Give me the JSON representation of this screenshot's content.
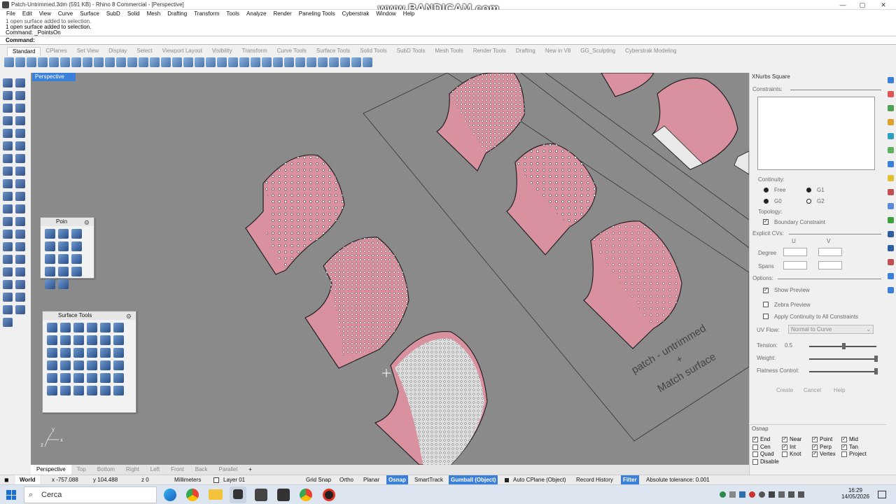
{
  "window": {
    "title": "Patch-Untrimmed.3dm (591 KB) - Rhino 8 Commercial - [Perspective]",
    "watermark": "www.BANDICAM.com",
    "minimize": "—",
    "maximize": "▢",
    "close": "✕"
  },
  "menu": [
    "File",
    "Edit",
    "View",
    "Curve",
    "Surface",
    "SubD",
    "Solid",
    "Mesh",
    "Drafting",
    "Transform",
    "Tools",
    "Analyze",
    "Render",
    "Paneling Tools",
    "Cyberstrak",
    "Window",
    "Help"
  ],
  "command": {
    "history": [
      "1 open surface added to selection.",
      "1 open surface added to selection.",
      "Command: _PointsOn"
    ],
    "prompt": "Command:"
  },
  "toolbar_tabs": [
    "Standard",
    "CPlanes",
    "Set View",
    "Display",
    "Select",
    "Viewport Layout",
    "Visibility",
    "Transform",
    "Curve Tools",
    "Surface Tools",
    "Solid Tools",
    "SubD Tools",
    "Mesh Tools",
    "Render Tools",
    "Drafting",
    "New in V8",
    "GG_Sculpting",
    "Cyberstrak Modeling"
  ],
  "viewport": {
    "label": "Perspective",
    "annotation_line1": "patch - untrimmed",
    "annotation_plus": "+",
    "annotation_line2": "Match surface",
    "axes_y": "y",
    "axes_z": "z",
    "axes_x": "x"
  },
  "float_panels": {
    "points": {
      "title": "Poin"
    },
    "surface": {
      "title": "Surface Tools"
    }
  },
  "bottom_tabs": [
    "Perspective",
    "Top",
    "Bottom",
    "Right",
    "Left",
    "Front",
    "Back",
    "Parallel",
    "+"
  ],
  "xnurbs": {
    "title": "XNurbs Square",
    "constraints": "Constraints:",
    "continuity": "Continuity:",
    "free": "Free",
    "g0": "G0",
    "g1": "G1",
    "g2": "G2",
    "topology": "Topology:",
    "boundary": "Boundary Constraint",
    "explicit": "Explicit CVs:",
    "u": "U",
    "v": "V",
    "degree": "Degree",
    "spans": "Spans",
    "options": "Options:",
    "show_preview": "Show Preview",
    "zebra": "Zebra Preview",
    "apply_cont": "Apply Continuity to All Constraints",
    "uv_flow": "UV Flow:",
    "uv_value": "Normal to Curve",
    "tension": "Tension:",
    "tension_val": "0.5",
    "tension_level": 0.5,
    "weight": "Weight:",
    "weight_level": 1.0,
    "flatness": "Flatness Control:",
    "flatness_level": 1.0,
    "create": "Create",
    "cancel": "Cancel",
    "help": "Help"
  },
  "osnap": {
    "title": "Osnap",
    "items": [
      {
        "label": "End",
        "checked": true
      },
      {
        "label": "Near",
        "checked": true
      },
      {
        "label": "Point",
        "checked": true
      },
      {
        "label": "Mid",
        "checked": true
      },
      {
        "label": "Cen",
        "checked": false
      },
      {
        "label": "Int",
        "checked": true
      },
      {
        "label": "Perp",
        "checked": true
      },
      {
        "label": "Tan",
        "checked": true
      },
      {
        "label": "Quad",
        "checked": false
      },
      {
        "label": "Knot",
        "checked": false
      },
      {
        "label": "Vertex",
        "checked": true
      },
      {
        "label": "Project",
        "checked": false
      },
      {
        "label": "Disable",
        "checked": false
      }
    ]
  },
  "status": {
    "world": "World",
    "x": "x -757.088",
    "y": "y 104.488",
    "z": "z 0",
    "units": "Millimeters",
    "layer": "Layer 01",
    "grid_snap": "Grid Snap",
    "ortho": "Ortho",
    "planar": "Planar",
    "osnap": "Osnap",
    "smarttrack": "SmartTrack",
    "gumball": "Gumball (Object)",
    "autocplane": "Auto CPlane (Object)",
    "history": "Record History",
    "filter": "Filter",
    "tolerance": "Absolute tolerance: 0.001"
  },
  "taskbar": {
    "search": "Cerca",
    "time": "16:29",
    "date": "14/05/2026"
  },
  "colors": {
    "surface_pink": "#d9909f",
    "viewport_bg": "#8a8a8a",
    "active_blue": "#3a7fd8"
  }
}
